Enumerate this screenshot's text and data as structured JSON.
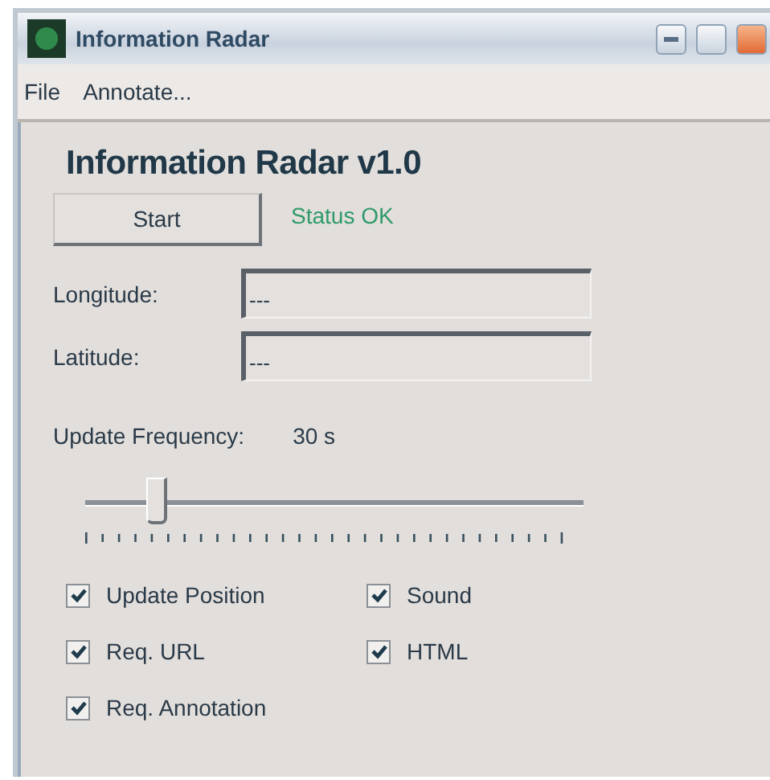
{
  "window": {
    "title": "Information Radar"
  },
  "menu": [
    {
      "label": "File"
    },
    {
      "label": "Annotate..."
    }
  ],
  "heading": "Information Radar v1.0",
  "start_button": "Start",
  "status": "Status OK",
  "fields": [
    {
      "label": "Longitude:",
      "value": "---"
    },
    {
      "label": "Latitude:",
      "value": "---"
    }
  ],
  "update_frequency": {
    "label": "Update Frequency:",
    "reading": "30 s",
    "level": 0.14
  },
  "options": [
    {
      "label": "Update Position",
      "checked": true
    },
    {
      "label": "Sound",
      "checked": true
    },
    {
      "label": "Req. URL",
      "checked": true
    },
    {
      "label": "HTML",
      "checked": true
    },
    {
      "label": "Req. Annotation",
      "checked": true
    }
  ]
}
